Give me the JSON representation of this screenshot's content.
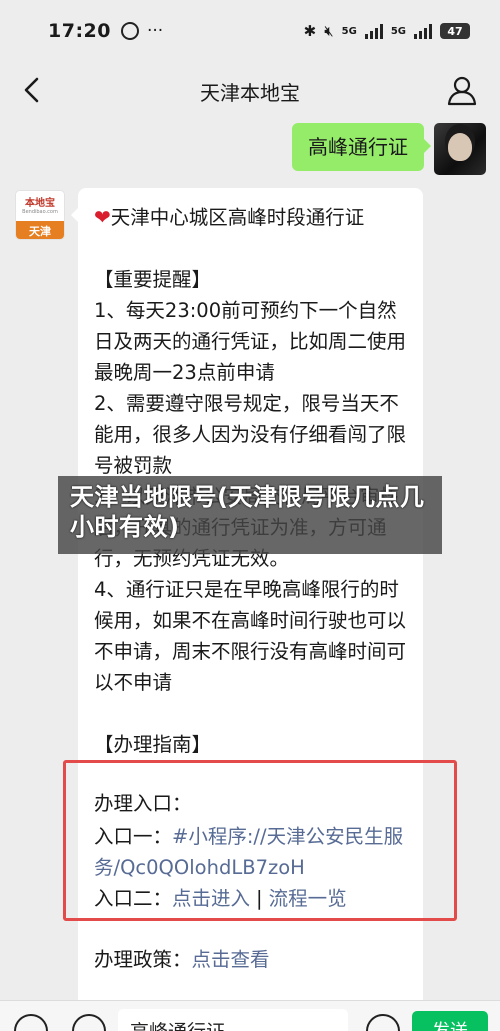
{
  "status_bar": {
    "time": "17:20",
    "extra": "···",
    "network1": "5G",
    "network2": "5G",
    "battery": "47"
  },
  "nav": {
    "title": "天津本地宝"
  },
  "user_message": {
    "text": "高峰通行证"
  },
  "bot_avatar": {
    "logo": "本地宝",
    "url": "Bendibao.com",
    "city": "天津"
  },
  "bot_message": {
    "heading": "天津中心城区高峰时段通行证",
    "reminder_title": "【重要提醒】",
    "item1": "1、每天23:00前可预约下一个自然日及两天的通行凭证，比如周二使用最晚周一23点前申请",
    "item2": "2、需要遵守限号规定，限号当天不能用，很多人因为没有仔细看闯了限号被罚款",
    "item3": "3、以天津市公安局交管局平台审核后，开具的通行凭证为准，方可通行，无预约凭证无效。",
    "item4": "4、通行证只是在早晚高峰限行的时候用，如果不在高峰时间行驶也可以不申请，周末不限行没有高峰时间可以不申请",
    "guide_title": "【办理指南】",
    "entry_label": "办理入口：",
    "entry1_label": "入口一：",
    "entry1_link": "#小程序://天津公安民生服务/Qc0QOlohdLB7zoH",
    "entry2_label": "入口二：",
    "entry2_link1": "点击进入",
    "entry2_sep": "|",
    "entry2_link2": "流程一览",
    "policy_label": "办理政策：",
    "policy_link": "点击查看"
  },
  "overlay": {
    "caption": "天津当地限号(天津限号限几点几小时有效)"
  },
  "input_bar": {
    "text": "高峰通行证",
    "send_label": "发送"
  }
}
